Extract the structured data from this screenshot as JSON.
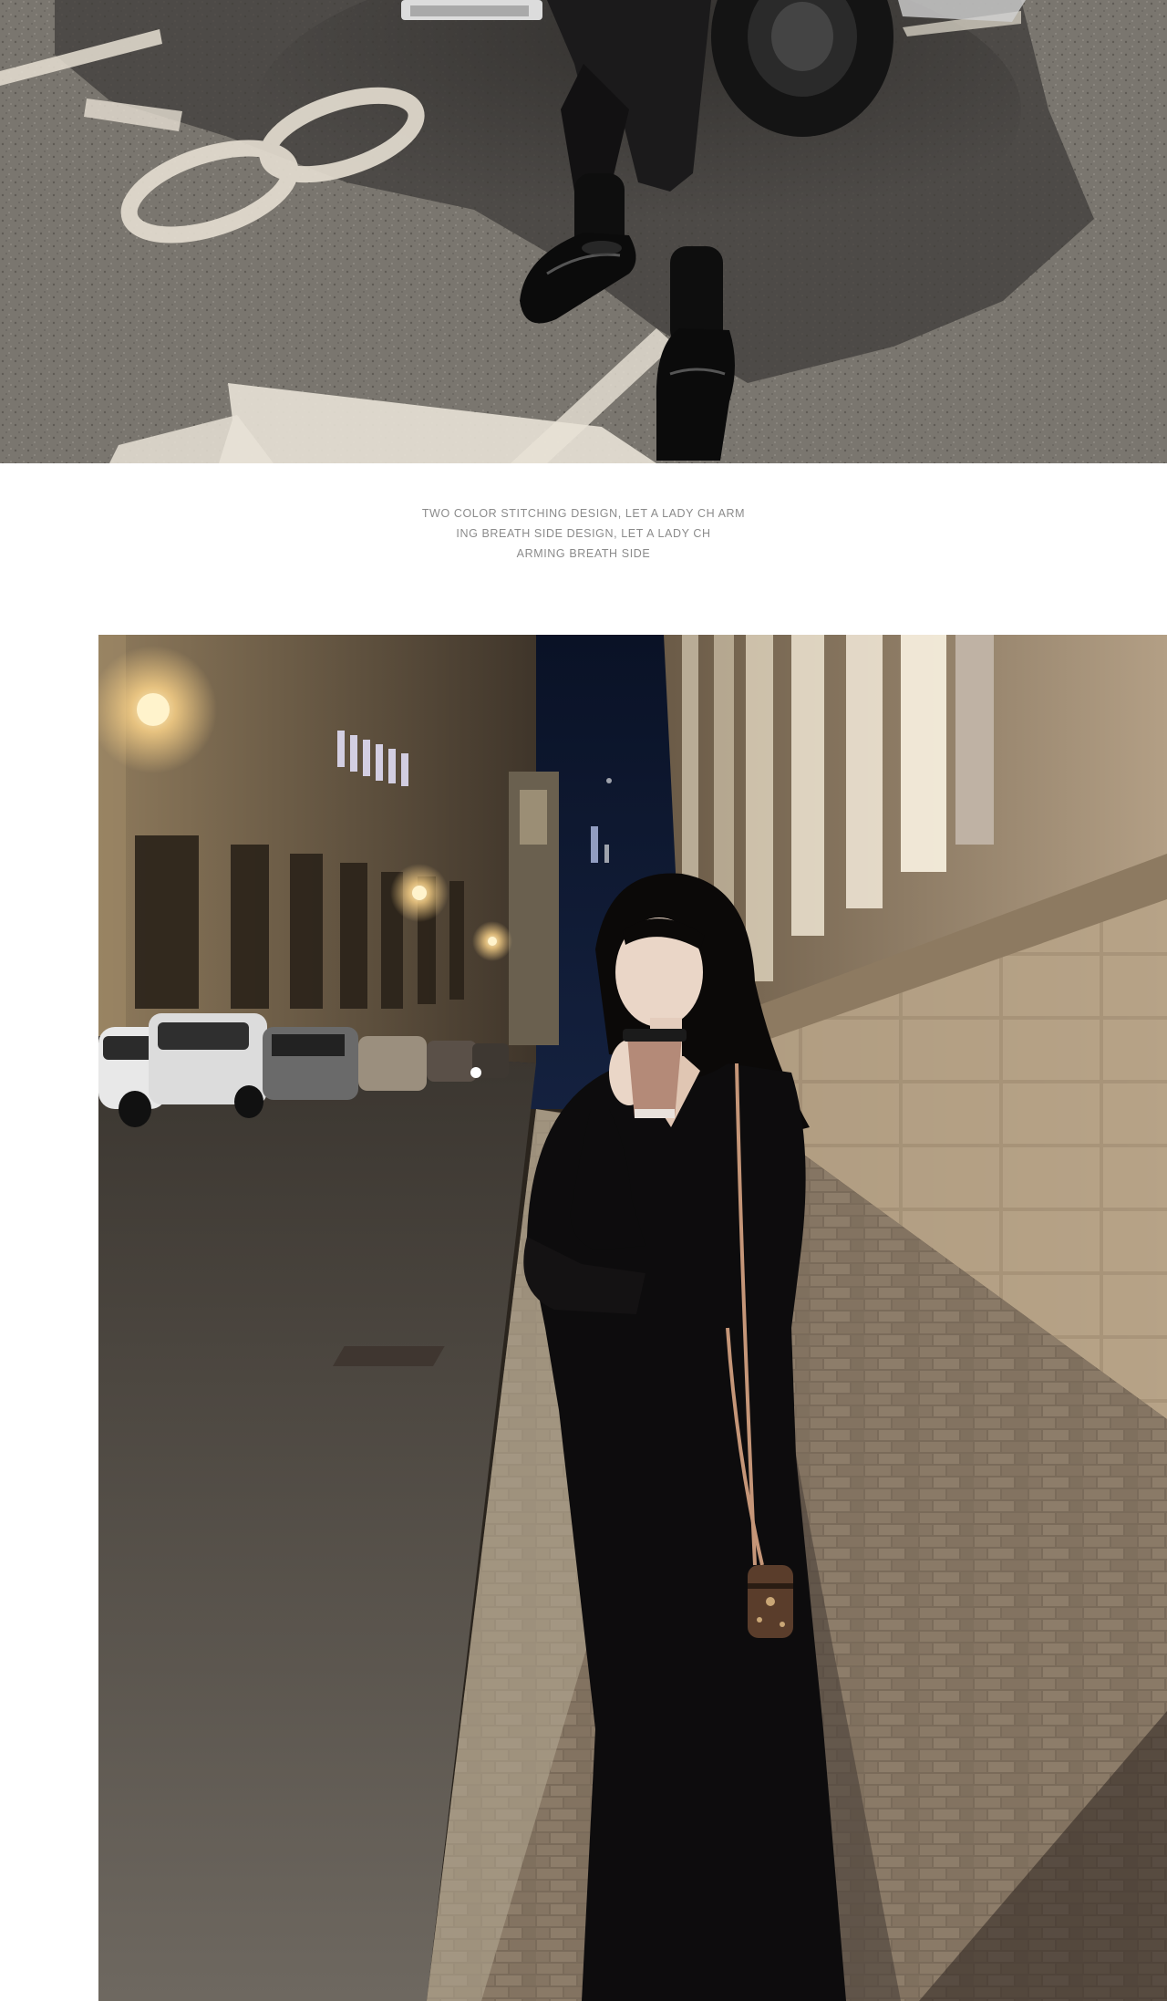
{
  "caption": {
    "line1": "TWO COLOR STITCHING DESIGN, LET A LADY CH ARM",
    "line2": "ING BREATH SIDE DESIGN, LET A LADY CH",
    "line3": "ARMING BREATH SIDE"
  },
  "photos": {
    "top": {
      "parking_marking": "8"
    }
  },
  "colors": {
    "page_background": "#ffffff",
    "caption_text": "#8b8b8b",
    "asphalt": "#7d7972",
    "road_paint": "#e8e2d6",
    "dress": "#0d0c0d",
    "night_sky": "#0e1a33",
    "street_light": "#ffd68a"
  }
}
